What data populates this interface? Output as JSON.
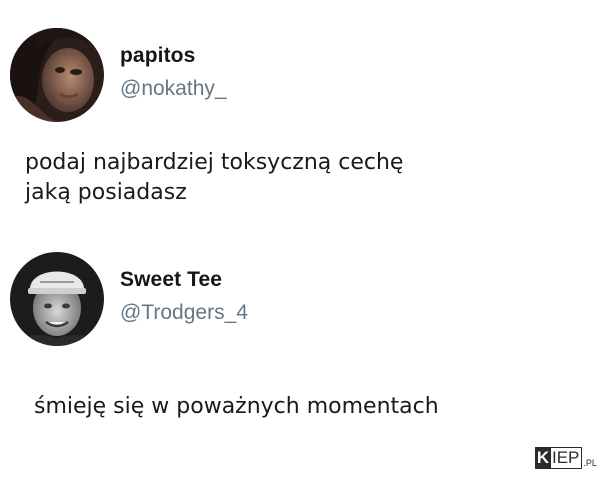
{
  "tweets": [
    {
      "display_name": "papitos",
      "handle": "@nokathy_",
      "text": "podaj najbardziej toksyczną cechę\njaką posiadasz",
      "avatar_icon": "profile-photo-woman"
    },
    {
      "display_name": "Sweet Tee",
      "handle": "@Trodgers_4",
      "text": "śmieję się w poważnych momentach",
      "avatar_icon": "profile-photo-man-cap"
    }
  ],
  "watermark": {
    "k": "K",
    "rest": "IEP",
    "suffix": ".PL"
  }
}
